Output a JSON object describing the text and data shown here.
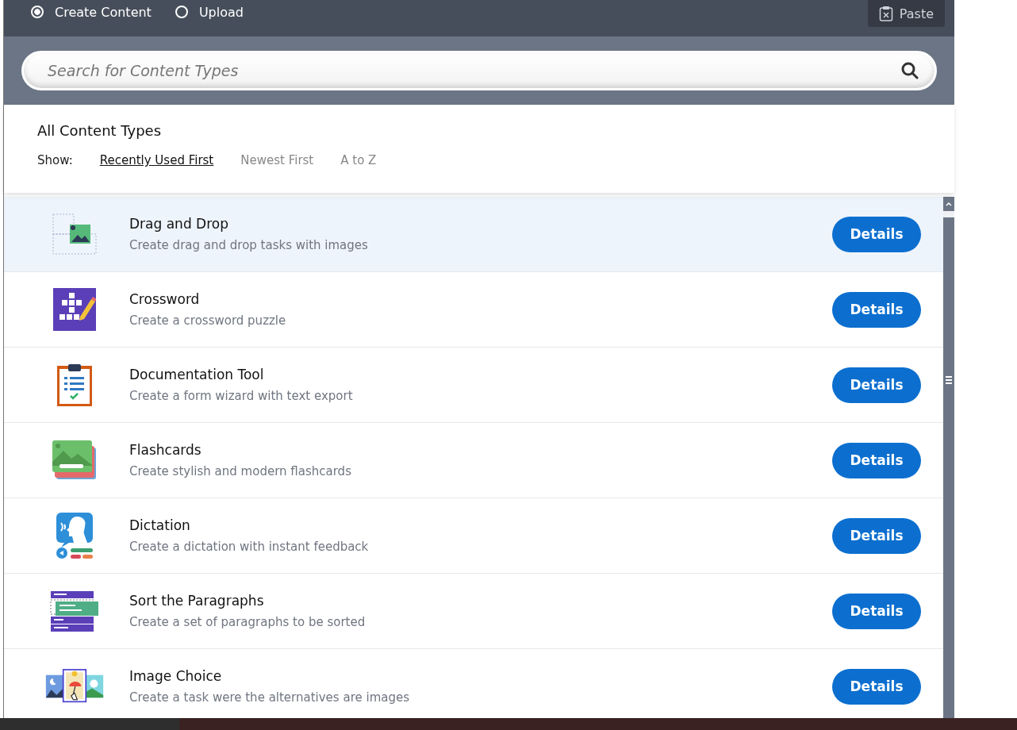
{
  "modes": [
    {
      "label": "Create Content",
      "selected": true
    },
    {
      "label": "Upload",
      "selected": false
    }
  ],
  "paste_button": {
    "label": "Paste"
  },
  "search": {
    "placeholder": "Search for Content Types"
  },
  "heading": "All Content Types",
  "sort": {
    "label": "Show:",
    "options": [
      {
        "label": "Recently Used First",
        "selected": true
      },
      {
        "label": "Newest First",
        "selected": false
      },
      {
        "label": "A to Z",
        "selected": false
      }
    ]
  },
  "content_types": [
    {
      "kind": "drag-drop",
      "title": "Drag and Drop",
      "description": "Create drag and drop tasks with images",
      "highlighted": true,
      "button": "Details"
    },
    {
      "kind": "crossword",
      "title": "Crossword",
      "description": "Create a crossword puzzle",
      "highlighted": false,
      "button": "Details"
    },
    {
      "kind": "documentation",
      "title": "Documentation Tool",
      "description": "Create a form wizard with text export",
      "highlighted": false,
      "button": "Details"
    },
    {
      "kind": "flashcards",
      "title": "Flashcards",
      "description": "Create stylish and modern flashcards",
      "highlighted": false,
      "button": "Details"
    },
    {
      "kind": "dictation",
      "title": "Dictation",
      "description": "Create a dictation with instant feedback",
      "highlighted": false,
      "button": "Details"
    },
    {
      "kind": "paragraphs",
      "title": "Sort the Paragraphs",
      "description": "Create a set of paragraphs to be sorted",
      "highlighted": false,
      "button": "Details"
    },
    {
      "kind": "image-choice",
      "title": "Image Choice",
      "description": "Create a task were the alternatives are images",
      "highlighted": false,
      "button": "Details"
    }
  ]
}
